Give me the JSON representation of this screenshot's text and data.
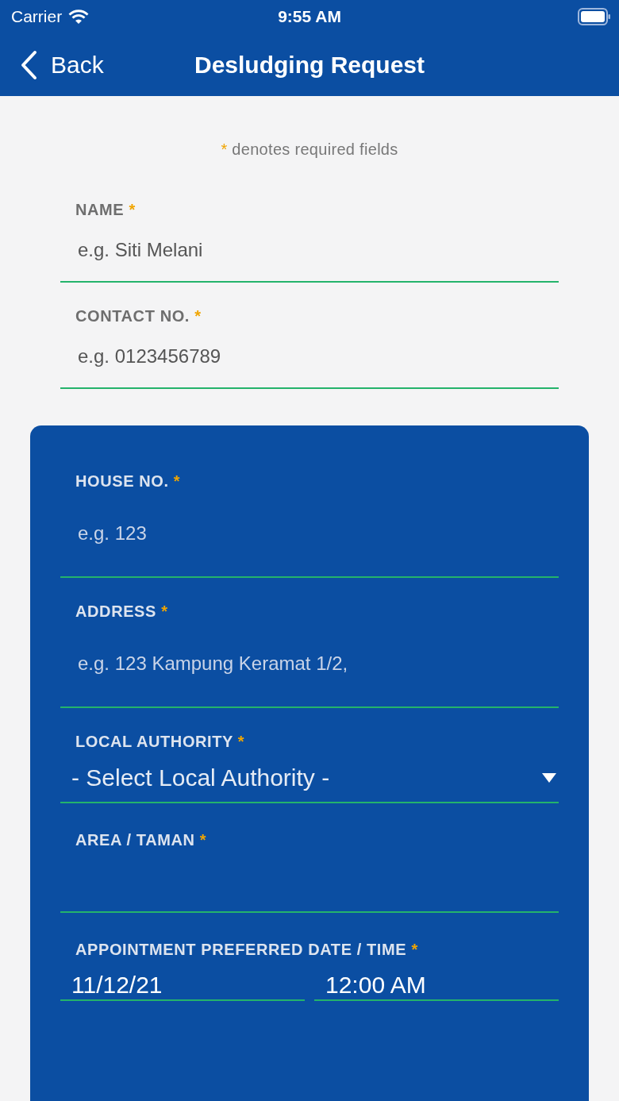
{
  "status_bar": {
    "carrier": "Carrier",
    "time": "9:55 AM"
  },
  "nav_bar": {
    "back_label": "Back",
    "title": "Desludging Request"
  },
  "note": {
    "marker": "*",
    "text": "denotes required fields"
  },
  "contact_section": {
    "fields": [
      {
        "kind": "text",
        "label": "NAME",
        "required_mark": "*",
        "placeholder": "e.g. Siti Melani"
      },
      {
        "kind": "text",
        "label": "CONTACT NO.",
        "required_mark": "*",
        "placeholder": "e.g. 0123456789"
      }
    ]
  },
  "address_card": {
    "fields": [
      {
        "kind": "text",
        "label": "HOUSE NO.",
        "required_mark": "*",
        "placeholder": "e.g. 123"
      },
      {
        "kind": "text",
        "label": "ADDRESS",
        "required_mark": "*",
        "placeholder": "e.g. 123 Kampung Keramat 1/2,"
      },
      {
        "kind": "select",
        "label": "LOCAL AUTHORITY",
        "required_mark": "*",
        "value": "- Select Local Authority -"
      },
      {
        "kind": "text",
        "label": "AREA / TAMAN",
        "required_mark": "*"
      },
      {
        "kind": "datetime",
        "label": "APPOINTMENT PREFERRED DATE / TIME",
        "required_mark": "*",
        "date": "11/12/21",
        "time": "12:00 AM"
      }
    ]
  }
}
